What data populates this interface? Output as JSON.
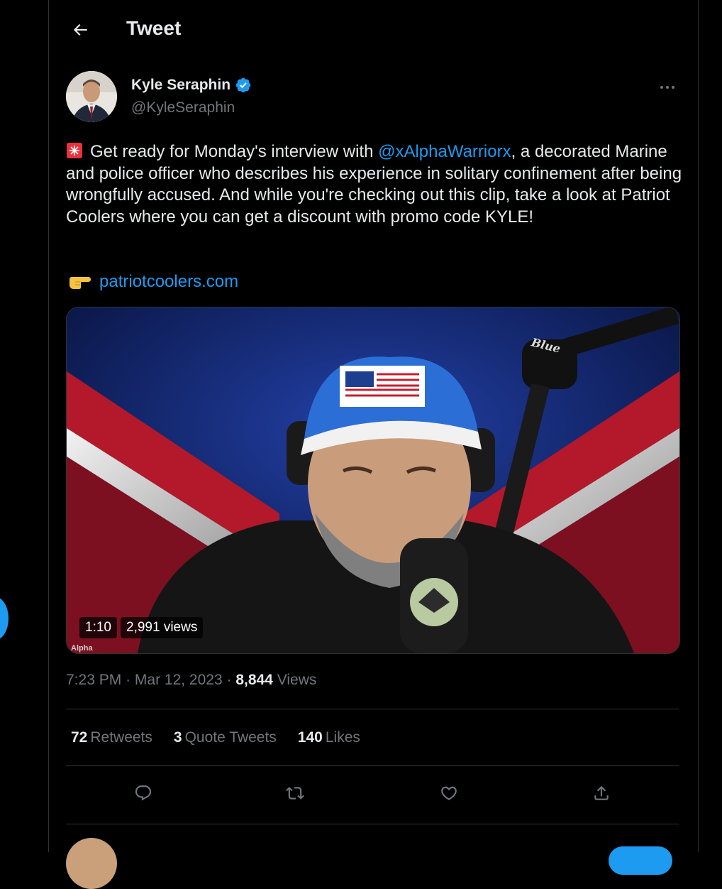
{
  "header": {
    "title": "Tweet"
  },
  "author": {
    "name": "Kyle Seraphin",
    "handle": "@KyleSeraphin"
  },
  "tweet": {
    "text_before_mention": "Get ready for Monday's interview with ",
    "mention": "@xAlphaWarriorx",
    "text_after_mention": ", a decorated Marine and police officer who describes his experience in solitary confinement after being wrongfully accused.  And while you're checking out this clip, take a look at Patriot Coolers where you can get a discount with promo code KYLE!",
    "link": "patriotcoolers.com"
  },
  "media": {
    "duration": "1:10",
    "views": "2,991 views",
    "watermark": "Alpha",
    "mic_brand": "Blue"
  },
  "meta": {
    "time": "7:23 PM",
    "date": "Mar 12, 2023",
    "views_count": "8,844",
    "views_label": "Views"
  },
  "stats": {
    "retweets_count": "72",
    "retweets_label": "Retweets",
    "quotes_count": "3",
    "quotes_label": "Quote Tweets",
    "likes_count": "140",
    "likes_label": "Likes"
  },
  "colors": {
    "accent": "#1d9bf0",
    "background": "#000000",
    "muted": "#71767b",
    "border": "#2f3336"
  },
  "icons": [
    "back-arrow-icon",
    "verified-badge-icon",
    "more-icon",
    "siren-icon",
    "pointing-hand-icon",
    "reply-icon",
    "retweet-icon",
    "like-icon",
    "share-icon"
  ]
}
